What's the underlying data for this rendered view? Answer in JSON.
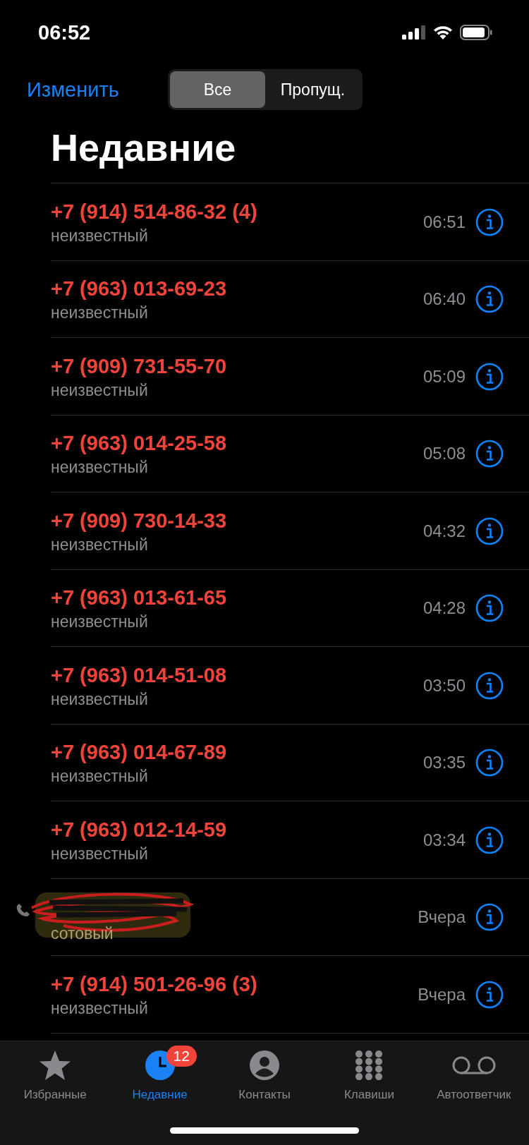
{
  "status_bar": {
    "time": "06:52"
  },
  "nav": {
    "edit": "Изменить",
    "segments": [
      {
        "label": "Все",
        "selected": true
      },
      {
        "label": "Пропущ.",
        "selected": false
      }
    ]
  },
  "title": "Недавние",
  "calls": [
    {
      "number": "+7 (914) 514-86-32 (4)",
      "type": "неизвестный",
      "time": "06:51",
      "missed": true,
      "redacted": false
    },
    {
      "number": "+7 (963) 013-69-23",
      "type": "неизвестный",
      "time": "06:40",
      "missed": true,
      "redacted": false
    },
    {
      "number": "+7 (909) 731-55-70",
      "type": "неизвестный",
      "time": "05:09",
      "missed": true,
      "redacted": false
    },
    {
      "number": "+7 (963) 014-25-58",
      "type": "неизвестный",
      "time": "05:08",
      "missed": true,
      "redacted": false
    },
    {
      "number": "+7 (909) 730-14-33",
      "type": "неизвестный",
      "time": "04:32",
      "missed": true,
      "redacted": false
    },
    {
      "number": "+7 (963) 013-61-65",
      "type": "неизвестный",
      "time": "04:28",
      "missed": true,
      "redacted": false
    },
    {
      "number": "+7 (963) 014-51-08",
      "type": "неизвестный",
      "time": "03:50",
      "missed": true,
      "redacted": false
    },
    {
      "number": "+7 (963) 014-67-89",
      "type": "неизвестный",
      "time": "03:35",
      "missed": true,
      "redacted": false
    },
    {
      "number": "+7 (963) 012-14-59",
      "type": "неизвестный",
      "time": "03:34",
      "missed": true,
      "redacted": false
    },
    {
      "type": "сотовый",
      "time": "Вчера",
      "missed": false,
      "redacted": true
    },
    {
      "number": "+7 (914) 501-26-96 (3)",
      "type": "неизвестный",
      "time": "Вчера",
      "missed": true,
      "redacted": false
    }
  ],
  "tab_bar": [
    {
      "kind": "favorites",
      "label": "Избранные",
      "selected": false
    },
    {
      "kind": "recents",
      "label": "Недавние",
      "selected": true,
      "badge": "12"
    },
    {
      "kind": "contacts",
      "label": "Контакты",
      "selected": false
    },
    {
      "kind": "keypad",
      "label": "Клавиши",
      "selected": false
    },
    {
      "kind": "voicemail",
      "label": "Автоответчик",
      "selected": false
    }
  ]
}
